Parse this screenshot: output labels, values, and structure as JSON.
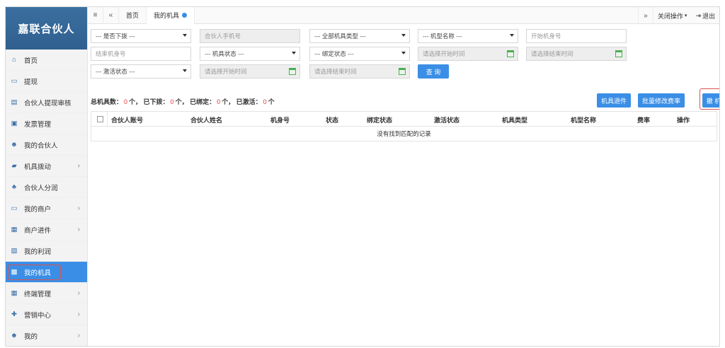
{
  "brand": "嘉联合伙人",
  "sidebar": {
    "items": [
      {
        "label": "首页",
        "icon": "home-icon",
        "chevron": false,
        "active": false
      },
      {
        "label": "提现",
        "icon": "card-icon",
        "chevron": false,
        "active": false
      },
      {
        "label": "合伙人提现审核",
        "icon": "document-icon",
        "chevron": false,
        "active": false
      },
      {
        "label": "发票管理",
        "icon": "invoice-icon",
        "chevron": false,
        "active": false
      },
      {
        "label": "我的合伙人",
        "icon": "users-icon",
        "chevron": false,
        "active": false
      },
      {
        "label": "机具拨动",
        "icon": "truck-icon",
        "chevron": true,
        "active": false
      },
      {
        "label": "合伙人分润",
        "icon": "sitemap-icon",
        "chevron": false,
        "active": false
      },
      {
        "label": "我的商户",
        "icon": "card-icon",
        "chevron": true,
        "active": false
      },
      {
        "label": "商户进件",
        "icon": "form-icon",
        "chevron": true,
        "active": false
      },
      {
        "label": "我的利润",
        "icon": "wallet-icon",
        "chevron": false,
        "active": false
      },
      {
        "label": "我的机具",
        "icon": "calculator-icon",
        "chevron": false,
        "active": true
      },
      {
        "label": "终端管理",
        "icon": "calendar-icon",
        "chevron": true,
        "active": false
      },
      {
        "label": "营销中心",
        "icon": "gift-icon",
        "chevron": true,
        "active": false
      },
      {
        "label": "我的",
        "icon": "user-icon",
        "chevron": true,
        "active": false
      }
    ]
  },
  "topbar": {
    "tabs": [
      {
        "label": "首页",
        "current": false
      },
      {
        "label": "我的机具",
        "current": true
      }
    ],
    "close_ops": "关闭操作",
    "logout": "退出"
  },
  "filters": {
    "row1": [
      {
        "type": "select",
        "text": "--- 是否下拨 ---"
      },
      {
        "type": "input",
        "placeholder": "合伙人手机号",
        "gray": true
      },
      {
        "type": "select",
        "text": "--- 全部机具类型 ---"
      },
      {
        "type": "select",
        "text": "--- 机型名称 ---"
      },
      {
        "type": "input",
        "placeholder": "开始机身号",
        "gray": false
      }
    ],
    "row2": [
      {
        "type": "input",
        "placeholder": "结束机身号",
        "gray": false
      },
      {
        "type": "select",
        "text": "--- 机具状态 ---"
      },
      {
        "type": "select",
        "text": "--- 绑定状态 ---"
      },
      {
        "type": "date",
        "placeholder": "请选择开始时间"
      },
      {
        "type": "date",
        "placeholder": "请选择结束时间"
      }
    ],
    "row3": [
      {
        "type": "select",
        "text": "--- 激活状态 ---"
      },
      {
        "type": "date",
        "placeholder": "请选择开始时间"
      },
      {
        "type": "date",
        "placeholder": "请选择结束时间"
      }
    ],
    "query_label": "查 询"
  },
  "summary": {
    "total_label": "总机具数：",
    "total": "0",
    "issued_label": "个，  已下拨：",
    "issued": "0",
    "bound_label": "个，  已绑定：",
    "bound": "0",
    "active_label": "个，  已激活：",
    "active": "0",
    "unit": "个"
  },
  "actions": {
    "return_label": "机具退件",
    "batch_rate_label": "批量修改费率",
    "withdraw_label": "撤 机"
  },
  "table": {
    "columns": [
      "合伙人账号",
      "合伙人姓名",
      "机身号",
      "状态",
      "绑定状态",
      "激活状态",
      "机具类型",
      "机型名称",
      "费率",
      "操作"
    ],
    "empty_text": "没有找到匹配的记录"
  },
  "colors": {
    "accent": "#3a8ee6",
    "brand_bg": "#2f5f8f",
    "highlight": "#d9534f",
    "count": "#e53935"
  }
}
